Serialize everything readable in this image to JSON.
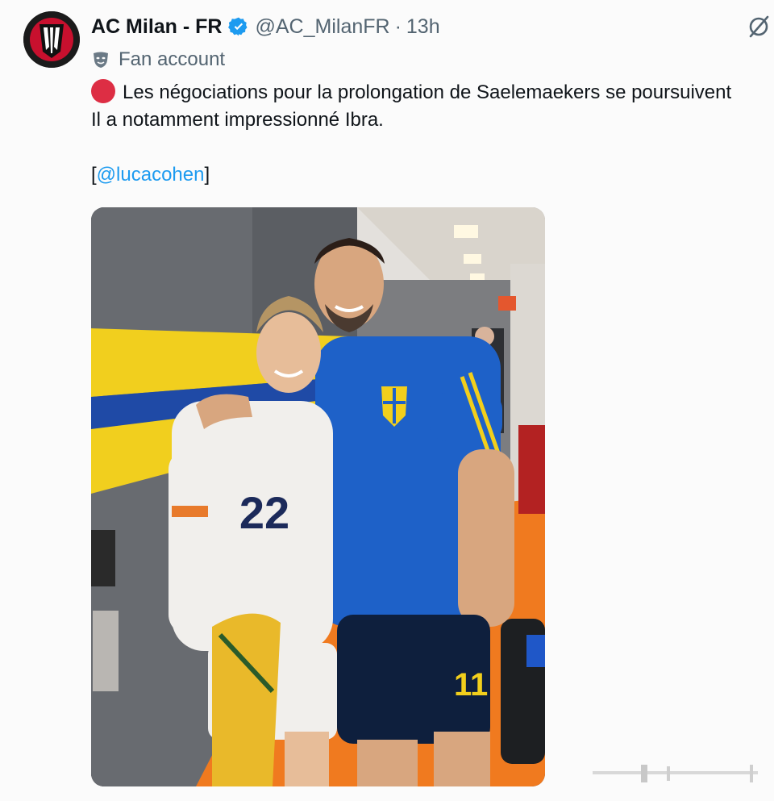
{
  "tweet": {
    "author": {
      "display_name": "AC Milan - FR",
      "handle": "@AC_MilanFR",
      "separator": "·",
      "time_ago": "13h",
      "label": "Fan account"
    },
    "text": {
      "line1": "Les négociations pour la prolongation de Saelemaekers se poursuivent",
      "line2": "Il a notamment impressionné Ibra.",
      "bracket_open": "[",
      "mention": "@lucacohen",
      "bracket_close": "]"
    },
    "media": {
      "jersey_left_number": "22",
      "jersey_right_number": "11"
    }
  },
  "colors": {
    "accent_blue": "#1d9bf0",
    "verified_blue": "#1d9bf0",
    "muted_text": "#536471",
    "red_circle": "#dd2e44"
  },
  "icons": {
    "verified": "verified-badge-icon",
    "grok": "grok-icon",
    "fan": "theater-mask-icon",
    "status": "red-circle-icon"
  }
}
